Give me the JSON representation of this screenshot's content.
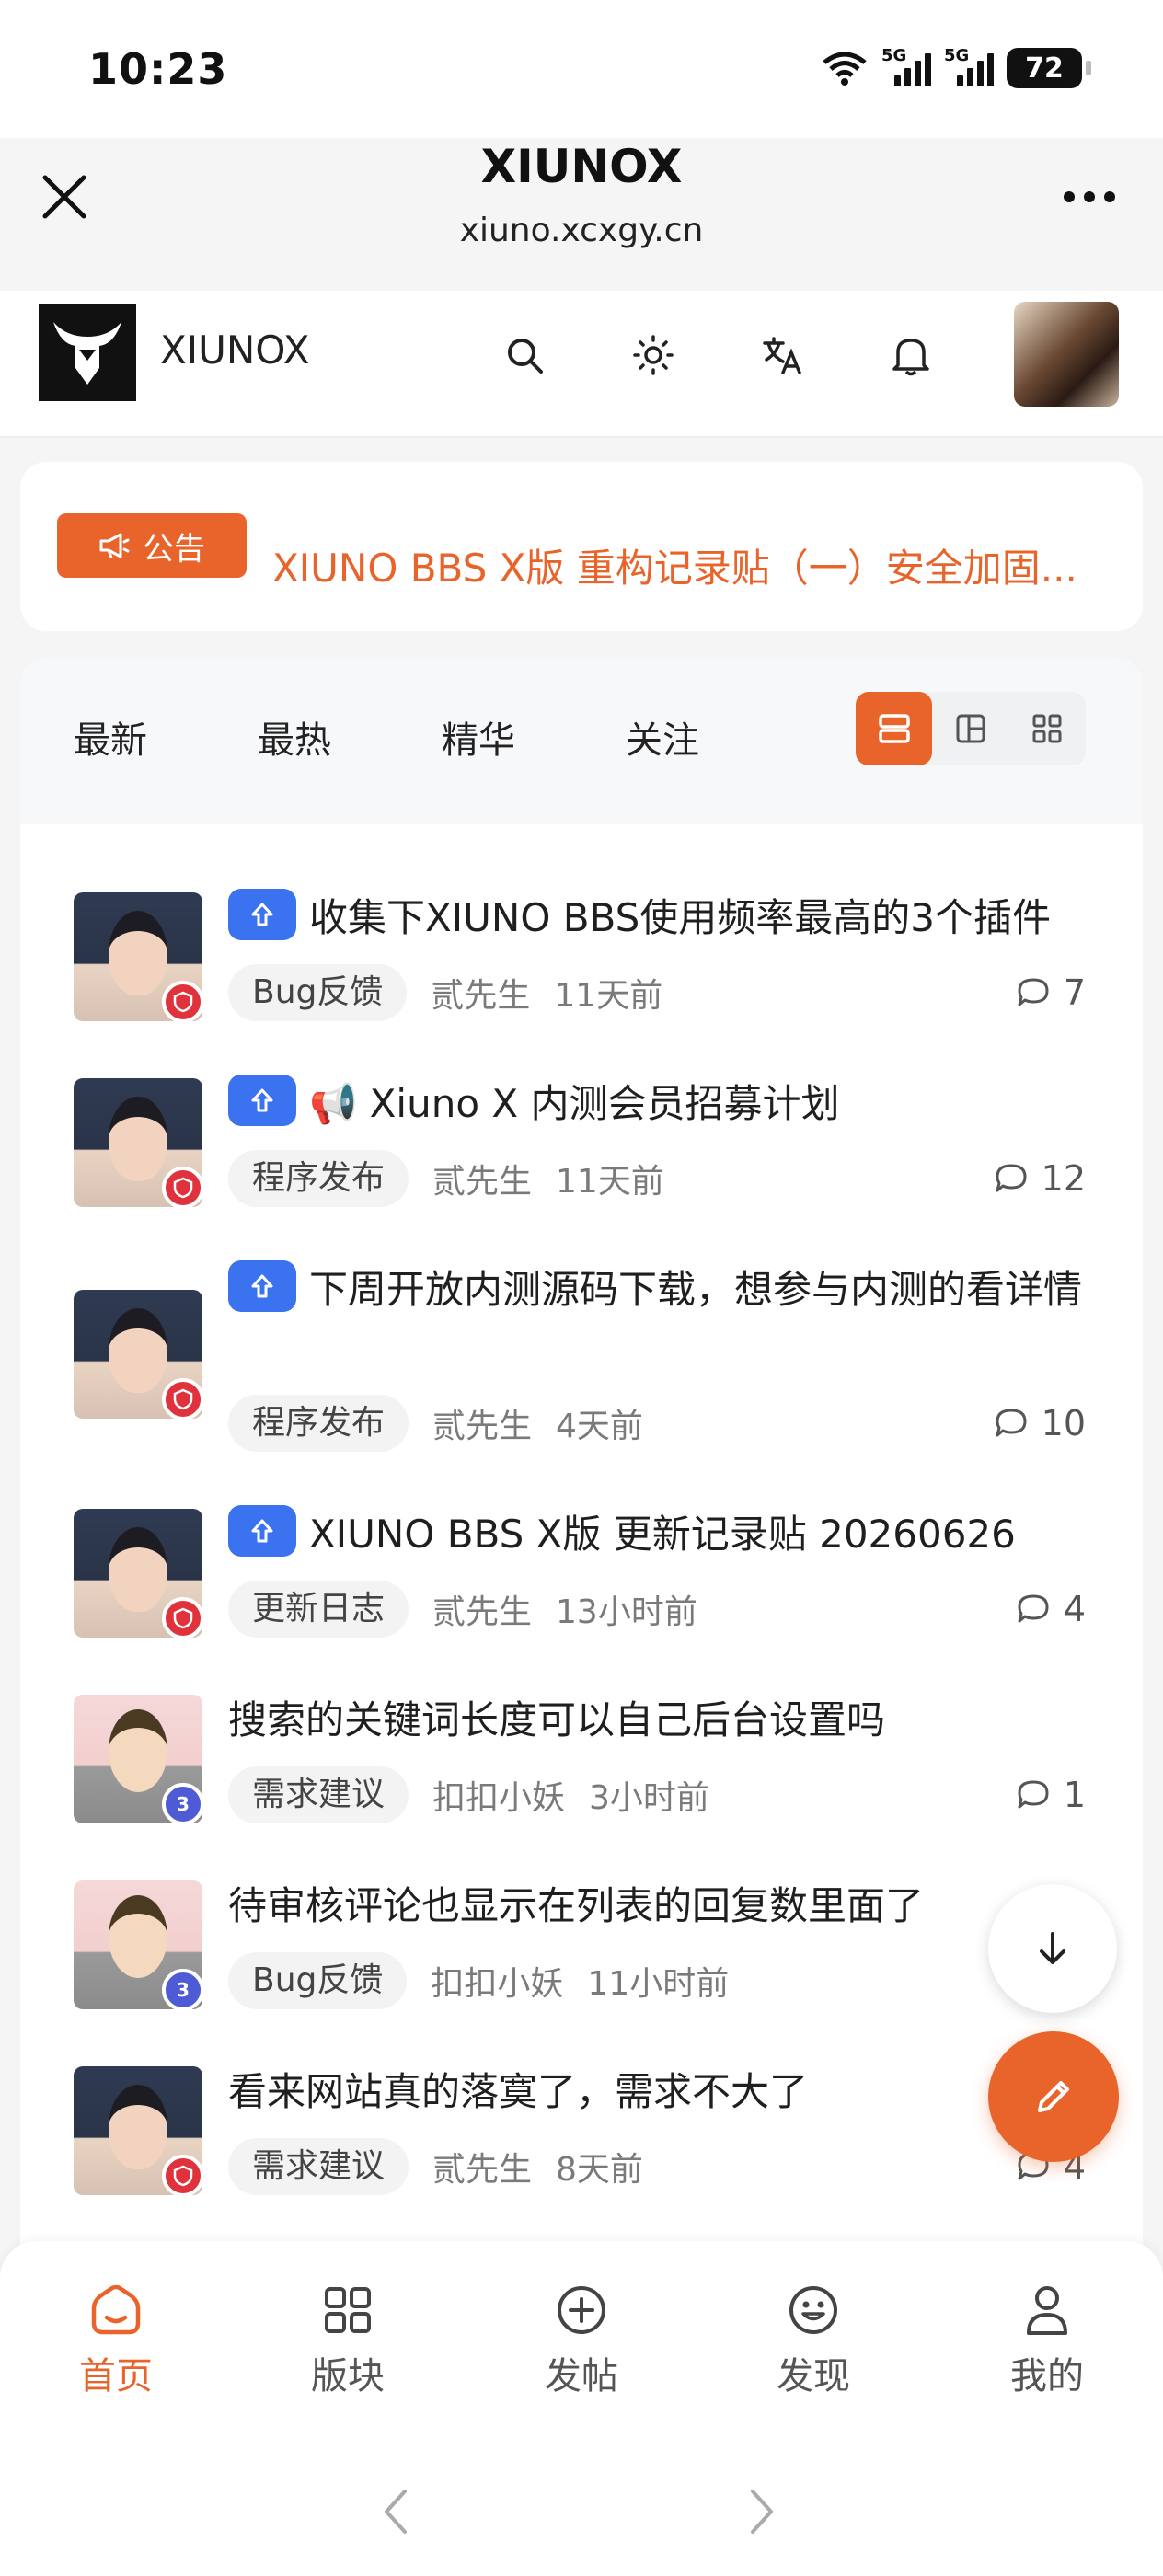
{
  "status_bar": {
    "time": "10:23",
    "signal1": "5G",
    "signal2": "5G",
    "battery": "72"
  },
  "browser": {
    "title": "XIUNOX",
    "url": "xiuno.xcxgy.cn"
  },
  "site_header": {
    "name": "XIUNOX"
  },
  "announcement": {
    "badge": "公告",
    "text": "XIUNO BBS X版 重构记录贴（一）安全加固..."
  },
  "tabs": [
    {
      "label": "最新"
    },
    {
      "label": "最热"
    },
    {
      "label": "精华"
    },
    {
      "label": "关注"
    }
  ],
  "posts": [
    {
      "title": "收集下XIUNO BBS使用频率最高的3个插件",
      "pinned": true,
      "tag": "Bug反馈",
      "author": "贰先生",
      "time": "11天前",
      "comments": "7",
      "avatar": "boy"
    },
    {
      "title": "📢 Xiuno X 内测会员招募计划",
      "pinned": true,
      "tag": "程序发布",
      "author": "贰先生",
      "time": "11天前",
      "comments": "12",
      "avatar": "boy"
    },
    {
      "title": "下周开放内测源码下载，想参与内测的看详情",
      "pinned": true,
      "tag": "程序发布",
      "author": "贰先生",
      "time": "4天前",
      "comments": "10",
      "avatar": "boy"
    },
    {
      "title": "XIUNO BBS X版 更新记录贴 20260626",
      "pinned": true,
      "tag": "更新日志",
      "author": "贰先生",
      "time": "13小时前",
      "comments": "4",
      "avatar": "boy"
    },
    {
      "title": "搜索的关键词长度可以自己后台设置吗",
      "pinned": false,
      "tag": "需求建议",
      "author": "扣扣小妖",
      "time": "3小时前",
      "comments": "1",
      "avatar": "nerd",
      "badge": "3"
    },
    {
      "title": "待审核评论也显示在列表的回复数里面了",
      "pinned": false,
      "tag": "Bug反馈",
      "author": "扣扣小妖",
      "time": "11小时前",
      "comments": "",
      "avatar": "nerd",
      "badge": "3"
    },
    {
      "title": "看来网站真的落寞了，需求不大了",
      "pinned": false,
      "tag": "需求建议",
      "author": "贰先生",
      "time": "8天前",
      "comments": "4",
      "avatar": "boy"
    }
  ],
  "bottom_nav": [
    {
      "label": "首页",
      "icon": "home-icon",
      "active": true
    },
    {
      "label": "版块",
      "icon": "grid-icon",
      "active": false
    },
    {
      "label": "发帖",
      "icon": "plus-circle-icon",
      "active": false
    },
    {
      "label": "发现",
      "icon": "smile-icon",
      "active": false
    },
    {
      "label": "我的",
      "icon": "user-icon",
      "active": false
    }
  ],
  "colors": {
    "accent": "#e8642a",
    "pin": "#3a72f0",
    "shield": "#e0323c"
  }
}
